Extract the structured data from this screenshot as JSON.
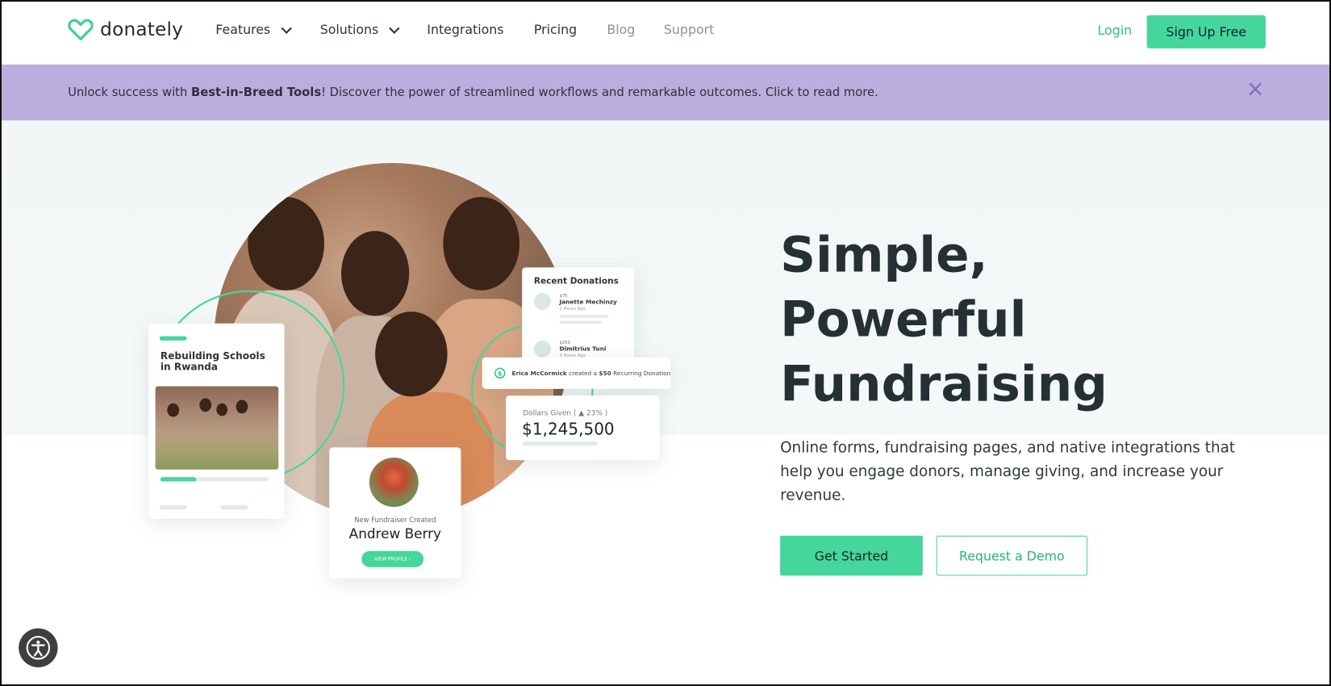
{
  "nav": {
    "logo": "donately",
    "items": [
      {
        "label": "Features",
        "dropdown": true
      },
      {
        "label": "Solutions",
        "dropdown": true
      },
      {
        "label": "Integrations"
      },
      {
        "label": "Pricing"
      },
      {
        "label": "Blog"
      },
      {
        "label": "Support"
      }
    ],
    "login": "Login",
    "signup": "Sign Up Free"
  },
  "banner": {
    "prefix": "Unlock success with ",
    "bold": "Best-in-Breed Tools",
    "suffix": "! Discover the power of streamlined workflows and remarkable outcomes. Click to read more.",
    "close": "×"
  },
  "hero": {
    "title_lines": [
      "Simple,",
      "Powerful",
      "Fundraising"
    ],
    "subtitle": "Online forms, fundraising pages, and native integrations that help you engage donors, manage giving, and increase your revenue.",
    "get_started": "Get Started",
    "request_demo": "Request a Demo"
  },
  "campaign_card": {
    "title": "Rebuilding Schools in Rwanda",
    "progress": 0.33
  },
  "recent": {
    "title": "Recent Donations",
    "items": [
      {
        "amount": "$75",
        "name": "Janette Mechinzy",
        "time": "2 Hours Ago"
      },
      {
        "amount": "$250",
        "name": "Dimitrius Tuni",
        "time": "3 Hours Ago"
      }
    ]
  },
  "notification": {
    "name": "Erica McCormick",
    "mid": " created a ",
    "amount": "$50",
    "tail": " Recurring Donation"
  },
  "stats": {
    "label": "Dollars Given ( ▲ 23% )",
    "value": "$1,245,500"
  },
  "fundraiser": {
    "caption": "New Fundraiser Created",
    "name": "Andrew Berry",
    "button": "VIEW PROFILE ›"
  },
  "colors": {
    "accent": "#45d69b",
    "banner": "#bbaedf",
    "heading": "#253035"
  }
}
